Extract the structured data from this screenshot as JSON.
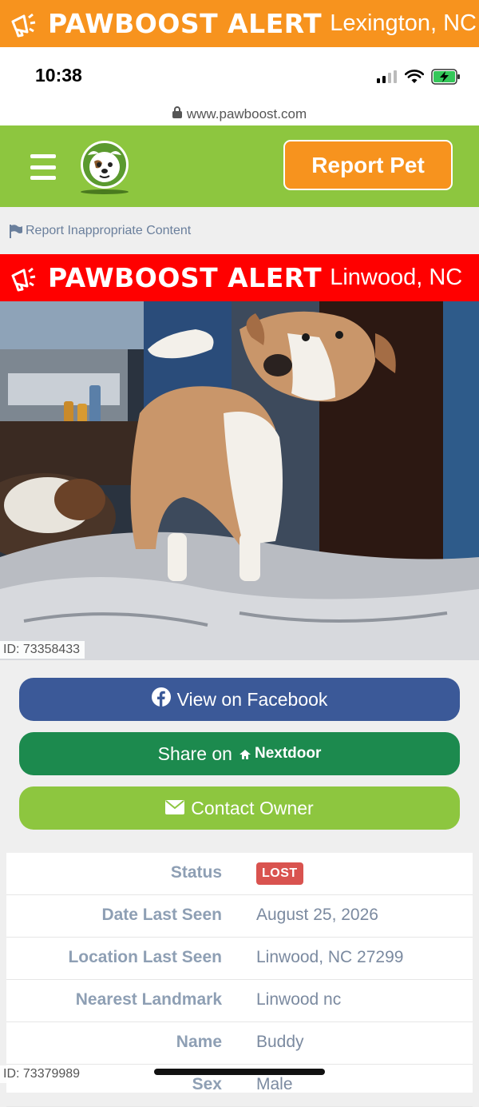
{
  "top_banner": {
    "brand": "PAWBOOST ALERT",
    "location": "Lexington, NC"
  },
  "status_bar": {
    "time": "10:38"
  },
  "url_bar": {
    "url": "www.pawboost.com"
  },
  "header": {
    "report_button": "Report Pet"
  },
  "report_link": "Report Inappropriate Content",
  "alert_banner": {
    "brand": "PAWBOOST ALERT",
    "location": "Linwood, NC"
  },
  "photo": {
    "id_label": "ID: 73358433",
    "subject": "dog"
  },
  "actions": {
    "facebook": "View on Facebook",
    "nextdoor_prefix": "Share on",
    "nextdoor_brand": "Nextdoor",
    "contact": "Contact Owner"
  },
  "details": [
    {
      "key": "Status",
      "value": "LOST",
      "badge": true
    },
    {
      "key": "Date Last Seen",
      "value": "August 25, 2026"
    },
    {
      "key": "Location Last Seen",
      "value": "Linwood, NC 27299"
    },
    {
      "key": "Nearest Landmark",
      "value": "Linwood nc"
    },
    {
      "key": "Name",
      "value": "Buddy"
    },
    {
      "key": "Sex",
      "value": "Male"
    }
  ],
  "footer_id": "ID: 73379989",
  "colors": {
    "orange": "#f7931e",
    "green": "#8dc63f",
    "red": "#ff0000",
    "facebook": "#3b5998",
    "nextdoor": "#1c8a4e",
    "lost_badge": "#d9534f"
  }
}
